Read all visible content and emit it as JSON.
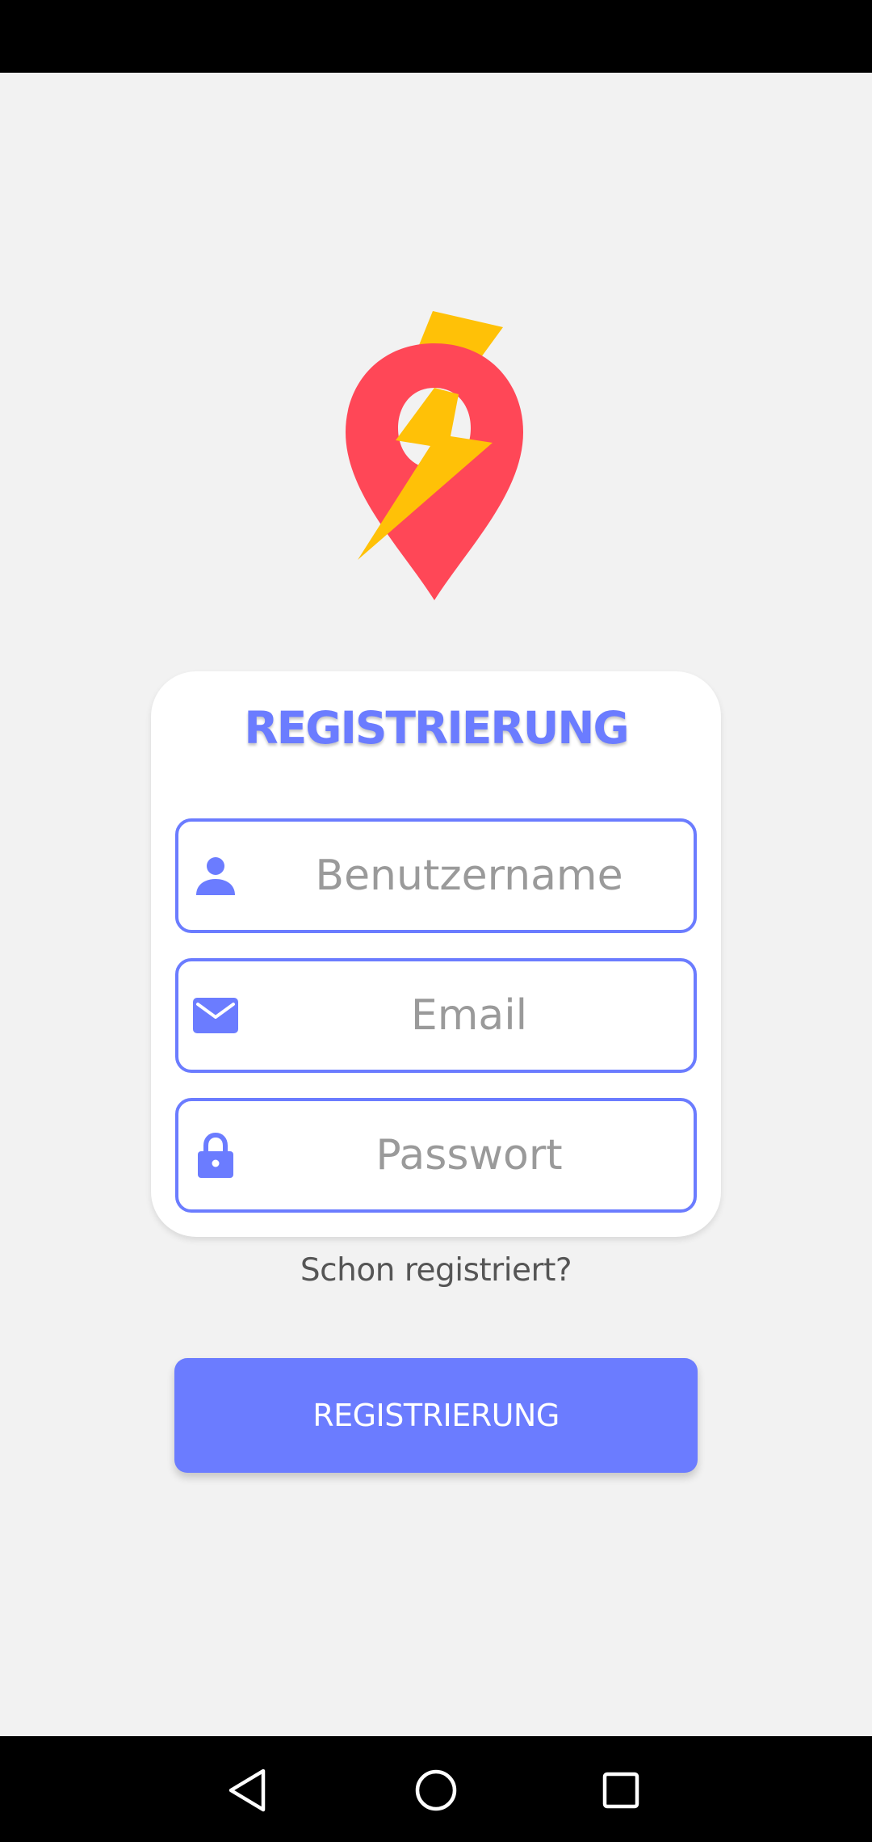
{
  "colors": {
    "accent": "#6b7cff",
    "logo_pin": "#ff4757",
    "logo_bolt": "#ffc107",
    "background": "#f2f2f2"
  },
  "logo": {
    "icon": "location-pin-lightning-logo"
  },
  "card": {
    "title": "REGISTRIERUNG",
    "fields": [
      {
        "icon": "person-icon",
        "placeholder": "Benutzername",
        "value": ""
      },
      {
        "icon": "mail-icon",
        "placeholder": "Email",
        "value": ""
      },
      {
        "icon": "lock-icon",
        "placeholder": "Passwort",
        "value": ""
      }
    ]
  },
  "login_link": "Schon registriert?",
  "register_button": "REGISTRIERUNG",
  "nav": {
    "back": "back-triangle-icon",
    "home": "home-circle-icon",
    "recent": "recent-apps-square-icon"
  }
}
